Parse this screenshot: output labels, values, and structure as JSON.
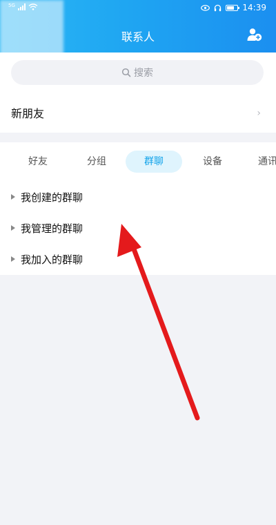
{
  "status": {
    "signal_label": "5G",
    "time": "14:39"
  },
  "header": {
    "title": "联系人"
  },
  "search": {
    "placeholder": "搜索"
  },
  "new_friends": {
    "label": "新朋友",
    "chevron": "›"
  },
  "tabs": [
    {
      "label": "好友"
    },
    {
      "label": "分组"
    },
    {
      "label": "群聊",
      "active": true
    },
    {
      "label": "设备"
    },
    {
      "label": "通讯"
    }
  ],
  "groups": [
    {
      "label": "我创建的群聊"
    },
    {
      "label": "我管理的群聊"
    },
    {
      "label": "我加入的群聊"
    }
  ],
  "colors": {
    "header": "#1fa6f2",
    "accent": "#12a3ea",
    "arrow": "#e41a1c"
  },
  "icons": [
    "signal-icon",
    "wifi-icon",
    "eye-icon",
    "headphones-icon",
    "battery-icon",
    "add-friend-icon",
    "search-icon",
    "chevron-right-icon",
    "triangle-icon"
  ]
}
